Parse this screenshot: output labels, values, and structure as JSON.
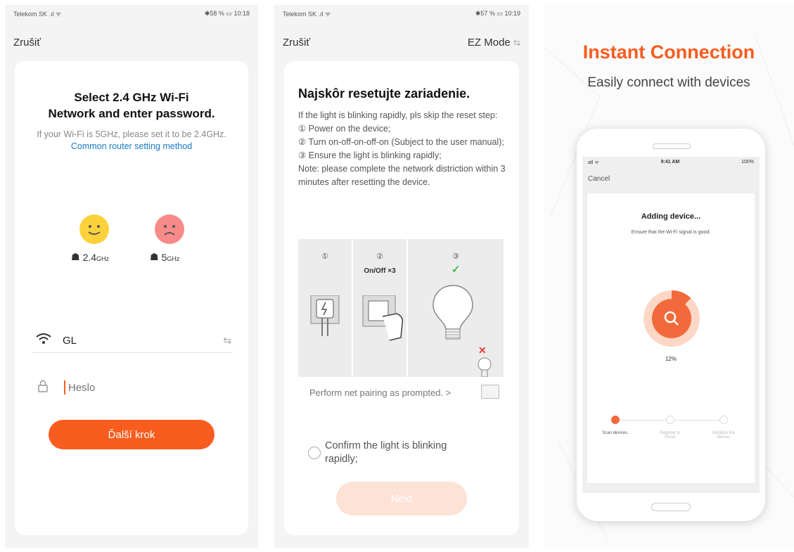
{
  "screen1": {
    "status": {
      "carrier": "Telekom SK",
      "battery": "58 %",
      "time": "10:18"
    },
    "cancel_label": "Zrušiť",
    "title": "Select 2.4 GHz Wi-Fi\nNetwork and enter password.",
    "subtitle": "If your Wi-Fi is 5GHz, please set it to be 2.4GHz.",
    "link": "Common router setting method",
    "band_good": {
      "value": "2.4",
      "unit": "GHz"
    },
    "band_bad": {
      "value": "5",
      "unit": "GHz"
    },
    "wifi_name": "GL",
    "password_placeholder": "Heslo",
    "next_label": "Ďalší krok",
    "accent": "#f95c1f"
  },
  "screen2": {
    "status": {
      "carrier": "Telekom SK",
      "battery": "57 %",
      "time": "10:19"
    },
    "cancel_label": "Zrušiť",
    "mode_label": "EZ Mode",
    "title": "Najskôr resetujte zariadenie.",
    "lines": [
      "If the light is blinking rapidly, pls skip the reset step:",
      "① Power on the device;",
      "② Turn on-off-on-off-on (Subject to the user manual);",
      "③ Ensure the light is blinking rapidly;",
      "Note: please complete the network distriction within 3 minutes after resetting the device."
    ],
    "steps": [
      {
        "num": "①",
        "caption": ""
      },
      {
        "num": "②",
        "caption": "On/Off ×3"
      },
      {
        "num": "③",
        "caption": ""
      }
    ],
    "perform_text": "Perform net pairing as prompted. >",
    "confirm_text": "Confirm the light is blinking rapidly;",
    "next_label": "Next"
  },
  "screen3": {
    "title": "Instant Connection",
    "subtitle": "Easily connect with devices",
    "phone": {
      "signal": "atl ᯤ",
      "time": "9:41 AM",
      "battery": "100%",
      "cancel_label": "Cancel",
      "heading": "Adding device...",
      "note": "Ensure that the Wi-Fi signal is good.",
      "progress_label": "12%",
      "progress": 0.12,
      "steps": [
        "Scan devices.",
        "Register to Cloud.",
        "Initialize the device."
      ]
    }
  }
}
